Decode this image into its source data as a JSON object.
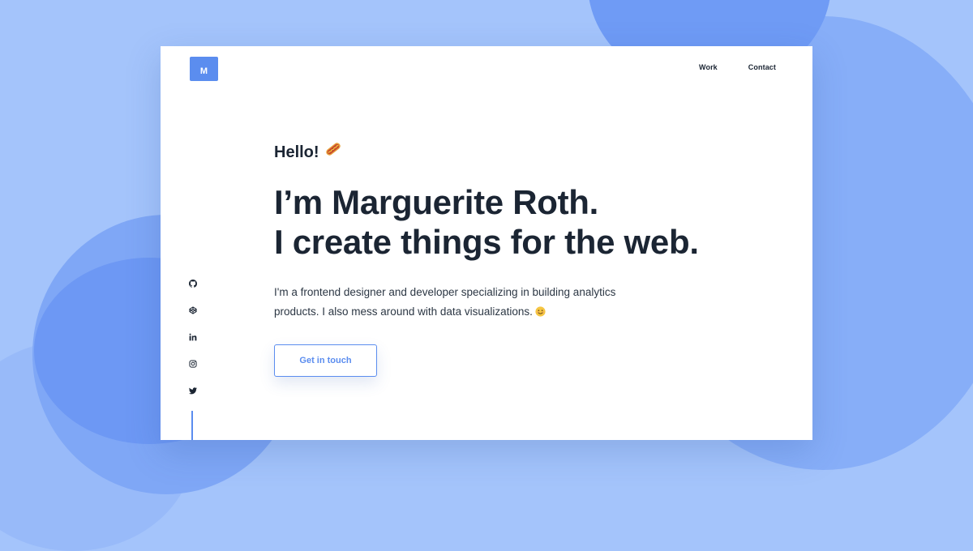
{
  "brand": {
    "logo_letter": "M",
    "accent_color": "#5b8def",
    "text_color": "#1b2533",
    "background_color": "#a4c4fb"
  },
  "nav": {
    "items": [
      {
        "label": "Work"
      },
      {
        "label": "Contact"
      }
    ]
  },
  "hero": {
    "greeting": "Hello!",
    "greeting_emoji": "hotdog-icon",
    "headline_line1": "I’m Marguerite Roth.",
    "headline_line2": "I create things for the web.",
    "bio": "I'm a frontend designer and developer specializing in building analytics products. I also mess around with data visualizations.",
    "bio_emoji": "smiling-face-icon",
    "cta_label": "Get in touch"
  },
  "social": {
    "icons": [
      "github-icon",
      "codepen-icon",
      "linkedin-icon",
      "instagram-icon",
      "twitter-icon"
    ]
  }
}
